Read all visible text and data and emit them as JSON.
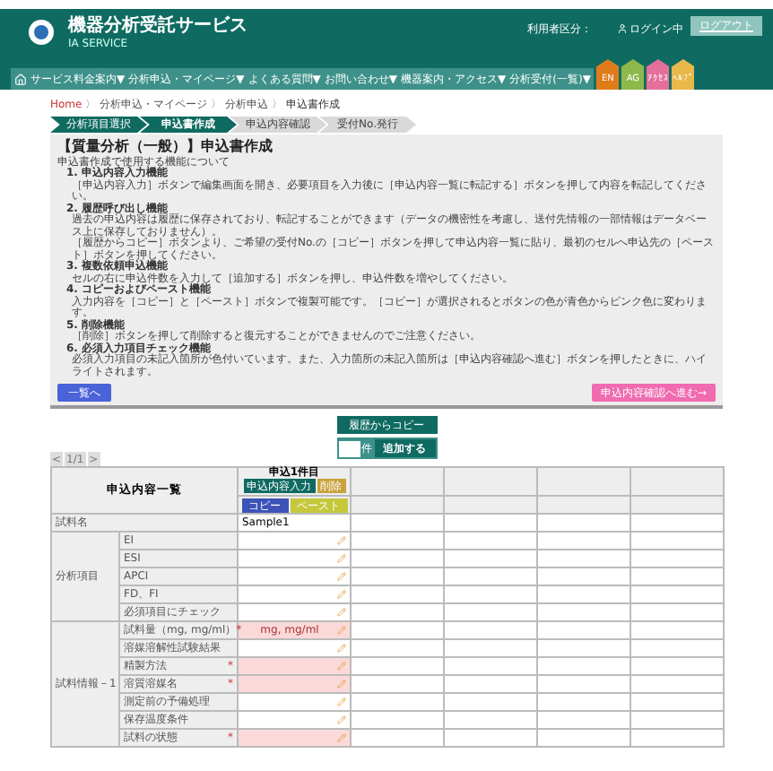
{
  "header": {
    "title": "機器分析受託サービス",
    "subtitle": "IA SERVICE",
    "user_type_label": "利用者区分：",
    "login_status": "ログイン中",
    "logout_button": "ログアウト"
  },
  "nav": {
    "items": [
      {
        "label": "サービス料金案内",
        "caret": "▼"
      },
      {
        "label": "分析申込・マイページ",
        "caret": "▼"
      },
      {
        "label": "よくある質問",
        "caret": "▼"
      },
      {
        "label": "お問い合わせ",
        "caret": "▼"
      },
      {
        "label": "機器案内・アクセス",
        "caret": "▼"
      },
      {
        "label": "分析受付(一覧)",
        "caret": "▼"
      }
    ],
    "tabs": [
      {
        "label": "EN",
        "color": "#e07b1a"
      },
      {
        "label": "AG",
        "color": "#8db84a"
      },
      {
        "label": "ｱｸｾｽ",
        "color": "#e46f9a"
      },
      {
        "label": "ﾍﾙﾌﾟ",
        "color": "#e8b84a"
      }
    ]
  },
  "breadcrumb": [
    {
      "label": "Home",
      "kind": "home"
    },
    {
      "label": "分析申込・マイページ",
      "kind": "link"
    },
    {
      "label": "分析申込",
      "kind": "link"
    },
    {
      "label": "申込書作成",
      "kind": "current"
    }
  ],
  "breadcrumb_separator": "〉",
  "steps": [
    {
      "label": "分析項目選択",
      "selected": false,
      "done": true
    },
    {
      "label": "申込書作成",
      "selected": true,
      "done": true
    },
    {
      "label": "申込内容確認",
      "selected": false,
      "done": false
    },
    {
      "label": "受付No.発行",
      "selected": false,
      "done": false
    }
  ],
  "panel": {
    "title": "【質量分析（一般）】申込書作成",
    "intro": "申込書作成で使用する機能について",
    "items": [
      {
        "heading": "1. 申込内容入力機能",
        "lines": [
          "［申込内容入力］ボタンで編集画面を開き、必要項目を入力後に［申込内容一覧に転記する］ボタンを押して内容を転記してください。"
        ]
      },
      {
        "heading": "2. 履歴呼び出し機能",
        "lines": [
          "過去の申込内容は履歴に保存されており、転記することができます（データの機密性を考慮し、送付先情報の一部情報はデータベース上に保存しておりません）。",
          "［履歴からコピー］ボタンより、ご希望の受付No.の［コピー］ボタンを押して申込内容一覧に貼り、最初のセルへ申込先の［ペースト］ボタンを押してください。"
        ]
      },
      {
        "heading": "3. 複数依頼申込機能",
        "lines": [
          "セルの右に申込件数を入力して［追加する］ボタンを押し、申込件数を増やしてください。"
        ]
      },
      {
        "heading": "4. コピーおよびペースト機能",
        "lines": [
          "入力内容を［コピー］と［ペースト］ボタンで複製可能です。［コピー］が選択されるとボタンの色が青色からピンク色に変わります。"
        ]
      },
      {
        "heading": "5. 削除機能",
        "lines": [
          "［削除］ボタンを押して削除すると復元することができませんのでご注意ください。"
        ]
      },
      {
        "heading": "6. 必須入力項目チェック機能",
        "lines": [
          "必須入力項目の未記入箇所が色付いています。また、入力箇所の未記入箇所は［申込内容確認へ進む］ボタンを押したときに、ハイライトされます。"
        ]
      }
    ],
    "back_button": "一覧へ",
    "next_button": "申込内容確認へ進む→"
  },
  "copy_history_button": "履歴からコピー",
  "add": {
    "unit": "件",
    "button": "追加する"
  },
  "pager": {
    "prev": "<",
    "page": "1/1",
    "next": ">"
  },
  "table": {
    "title": "申込内容一覧",
    "column_1": {
      "heading": "申込1件目",
      "input_button": "申込内容入力",
      "delete_button": "削除",
      "copy_button": "コピー",
      "paste_button": "ペースト"
    },
    "groups": [
      {
        "label": "試料名",
        "rows": [
          {
            "value": "Sample1",
            "required": false
          }
        ]
      },
      {
        "label": "分析項目",
        "rows": [
          {
            "label": "EI",
            "required": false
          },
          {
            "label": "ESI",
            "required": false
          },
          {
            "label": "APCI",
            "required": false
          },
          {
            "label": "FD、FI",
            "required": false
          },
          {
            "label": "必須項目にチェック",
            "required": false
          }
        ]
      },
      {
        "label": "試料情報－1",
        "rows": [
          {
            "label": "試料量（mg, mg/ml）",
            "mark": "*",
            "value": "mg, mg/ml",
            "required": true
          },
          {
            "label": "溶媒溶解性試験結果",
            "required": false
          },
          {
            "label": "精製方法",
            "mark": "*",
            "required": true
          },
          {
            "label": "溶質溶媒名",
            "mark": "*",
            "required": true
          },
          {
            "label": "測定前の予備処理",
            "required": false
          },
          {
            "label": "保存温度条件",
            "required": false
          },
          {
            "label": "試料の状態",
            "mark": "*",
            "required": true
          }
        ]
      }
    ]
  }
}
